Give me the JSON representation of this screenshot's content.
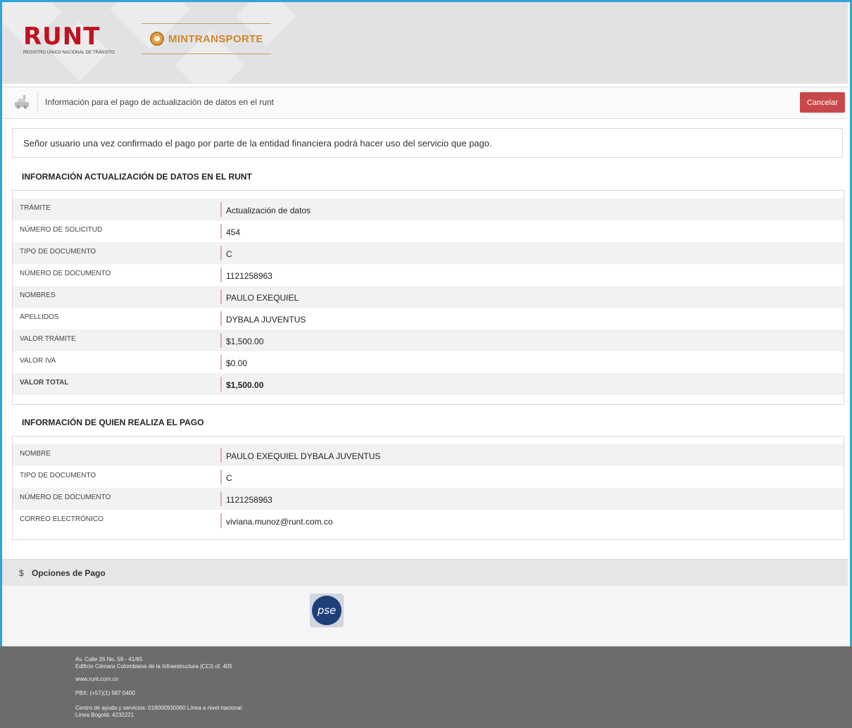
{
  "header": {
    "runt_logo_text": "RUNT",
    "runt_logo_subtitle": "REGISTRO ÚNICO NACIONAL DE TRÁNSITO",
    "min_logo_text": "MINTRANSPORTE"
  },
  "titlebar": {
    "title": "Información para el pago de actualización de datos en el runt",
    "cancel_label": "Cancelar"
  },
  "notice": "Señor usuario una vez confirmado el pago por parte de la entidad financiera podrá hacer uso del servicio que pago.",
  "section1": {
    "title": "INFORMACIÓN ACTUALIZACIÓN DE DATOS EN EL RUNT",
    "rows": [
      {
        "label": "TRÁMITE",
        "value": "Actualización de datos"
      },
      {
        "label": "NÚMERO DE SOLICITUD",
        "value": "454"
      },
      {
        "label": "TIPO DE DOCUMENTO",
        "value": "C"
      },
      {
        "label": "NÚMERO DE DOCUMENTO",
        "value": "1121258963"
      },
      {
        "label": "NOMBRES",
        "value": "PAULO EXEQUIEL"
      },
      {
        "label": "APELLIDOS",
        "value": "DYBALA JUVENTUS"
      },
      {
        "label": "VALOR TRÁMITE",
        "value": "$1,500.00"
      },
      {
        "label": "VALOR IVA",
        "value": "$0.00"
      },
      {
        "label": "VALOR TOTAL",
        "value": "$1,500.00"
      }
    ]
  },
  "section2": {
    "title": "INFORMACIÓN DE QUIEN REALIZA EL PAGO",
    "rows": [
      {
        "label": "NOMBRE",
        "value": "PAULO EXEQUIEL DYBALA JUVENTUS"
      },
      {
        "label": "TIPO DE DOCUMENTO",
        "value": "C"
      },
      {
        "label": "NÚMERO DE DOCUMENTO",
        "value": "1121258963"
      },
      {
        "label": "CORREO ELECTRÓNICO",
        "value": "viviana.munoz@runt.com.co"
      }
    ]
  },
  "payment": {
    "symbol": "$",
    "title": "Opciones de Pago",
    "pse_label": "pse"
  },
  "footer": {
    "address_line1": "Av. Calle 26 No. 59 - 41/65",
    "address_line2": "Edificio Cámara Colombiana de la Infraestructura (CCI) of. 405",
    "website": "www.runt.com.co",
    "pbx": "PBX: (+57)(1) 587 0400",
    "help_line1": "Centro de ayuda y servicios: 018000930060 Línea a nivel nacional",
    "help_line2": "Línea Bogotá: 4232221"
  },
  "colors": {
    "frame": "#2ea3dc",
    "cancel_button": "#c9484a",
    "runt_red": "#c1121f",
    "mintransporte_orange": "#d3872c",
    "footer_bg": "#6e6b6b"
  }
}
